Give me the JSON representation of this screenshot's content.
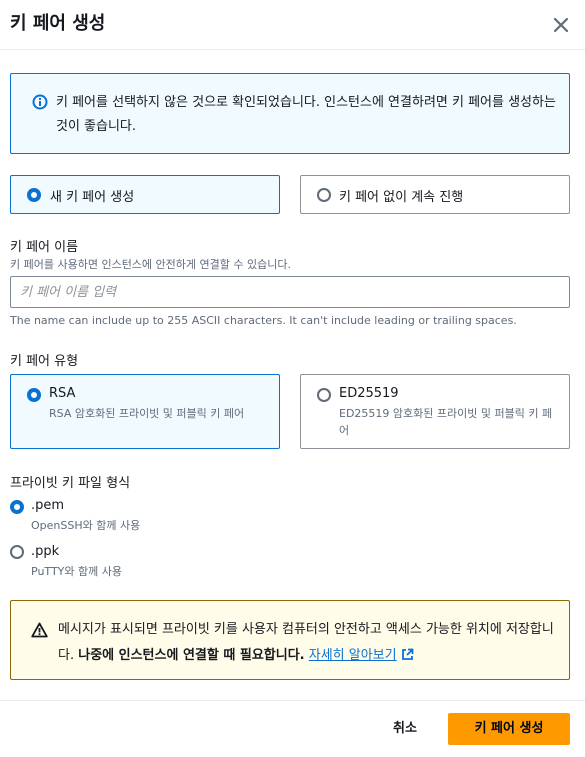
{
  "header": {
    "title": "키 페어 생성",
    "close_icon": "close-icon"
  },
  "info": {
    "icon": "info-icon",
    "text": "키 페어를 선택하지 않은 것으로 확인되었습니다. 인스턴스에 연결하려면 키 페어를 생성하는 것이 좋습니다."
  },
  "key_choice": {
    "create_label": "새 키 페어 생성",
    "skip_label": "키 페어 없이 계속 진행",
    "selected": "create"
  },
  "key_name": {
    "label": "키 페어 이름",
    "description": "키 페어를 사용하면 인스턴스에 안전하게 연결할 수 있습니다.",
    "placeholder": "키 페어 이름 입력",
    "value": "",
    "constraint": "The name can include up to 255 ASCII characters. It can't include leading or trailing spaces."
  },
  "key_type": {
    "label": "키 페어 유형",
    "options": [
      {
        "label": "RSA",
        "description": "RSA 암호화된 프라이빗 및 퍼블릭 키 페어",
        "selected": true
      },
      {
        "label": "ED25519",
        "description": "ED25519 암호화된 프라이빗 및 퍼블릭 키 페어",
        "selected": false
      }
    ]
  },
  "file_format": {
    "label": "프라이빗 키 파일 형식",
    "options": [
      {
        "label": ".pem",
        "description": "OpenSSH와 함께 사용",
        "selected": true
      },
      {
        "label": ".ppk",
        "description": "PuTTY와 함께 사용",
        "selected": false
      }
    ]
  },
  "warning": {
    "icon": "warning-icon",
    "text": "메시지가 표시되면 프라이빗 키를 사용자 컴퓨터의 안전하고 액세스 가능한 위치에 저장합니다.",
    "bold_text": "나중에 인스턴스에 연결할 때 필요합니다.",
    "link_text": "자세히 알아보기",
    "link_icon": "external-link-icon"
  },
  "footer": {
    "cancel_label": "취소",
    "create_label": "키 페어 생성"
  },
  "colors": {
    "accent": "#0972d3",
    "primary_button": "#ff9900",
    "info_bg": "#f1faff",
    "warning_bg": "#fffce9",
    "warning_border": "#8d6605"
  }
}
